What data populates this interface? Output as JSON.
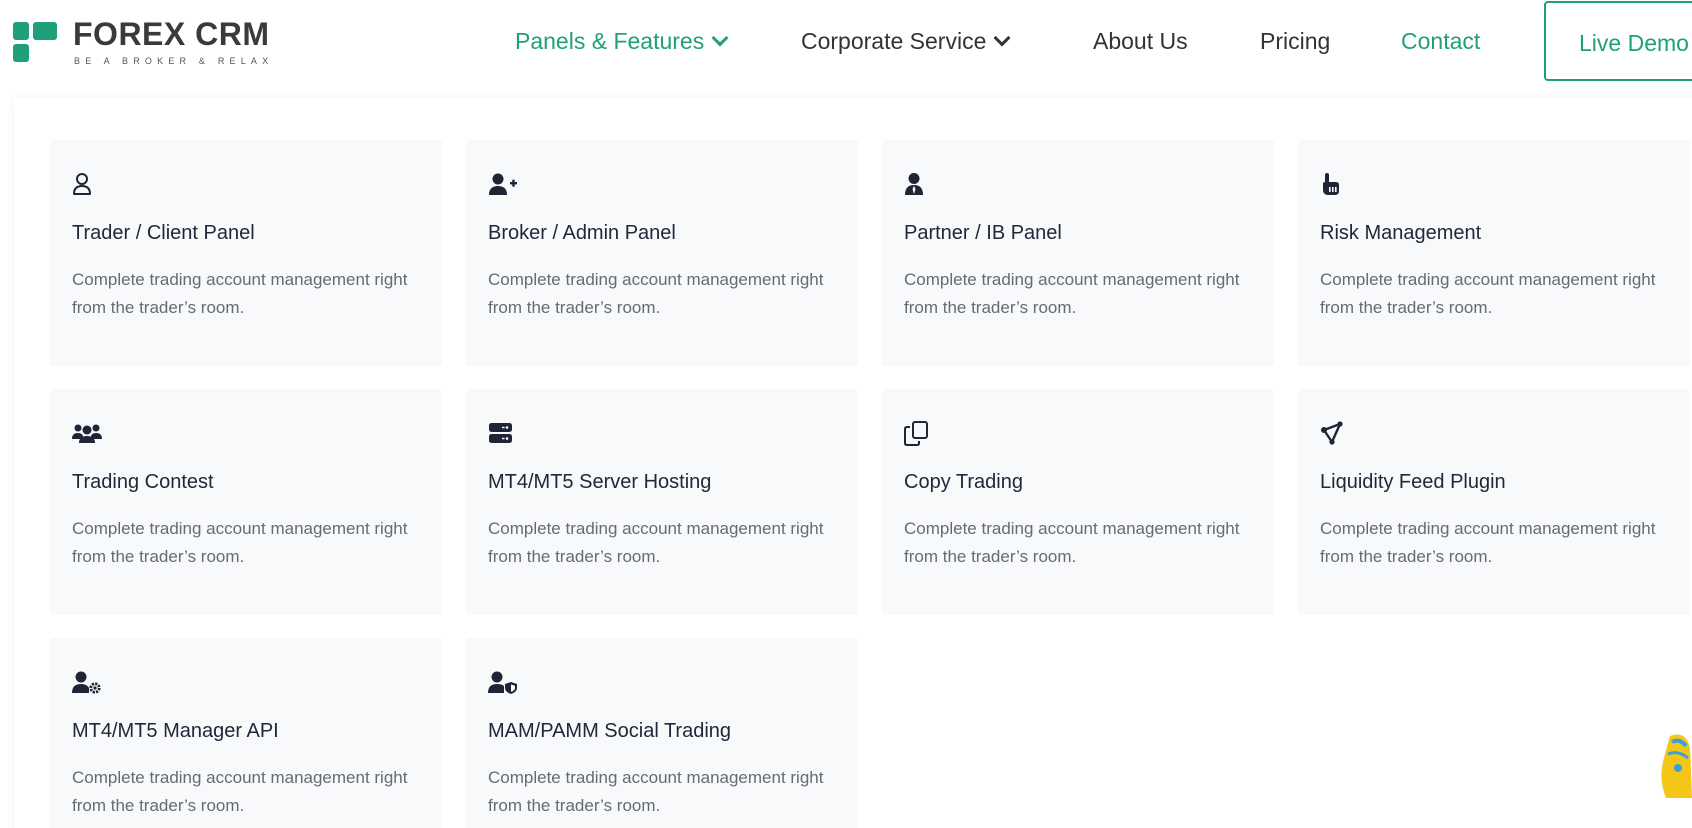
{
  "brand": {
    "name": "FOREX CRM",
    "tagline": "BE A BROKER & RELAX",
    "accent_color": "#1fa07a"
  },
  "nav": {
    "items": [
      {
        "label": "Panels & Features",
        "has_dropdown": true,
        "active": true
      },
      {
        "label": "Corporate Service",
        "has_dropdown": true,
        "active": false
      },
      {
        "label": "About Us",
        "has_dropdown": false,
        "active": false
      },
      {
        "label": "Pricing",
        "has_dropdown": false,
        "active": false
      },
      {
        "label": "Contact",
        "has_dropdown": false,
        "active": false
      }
    ],
    "cta_label": "Live Demo"
  },
  "features": [
    {
      "icon": "user-outline-icon",
      "title": "Trader / Client Panel",
      "desc": "Complete trading account management right from the trader’s room."
    },
    {
      "icon": "user-plus-icon",
      "title": "Broker / Admin Panel",
      "desc": "Complete trading account management right from the trader’s room."
    },
    {
      "icon": "user-tie-icon",
      "title": "Partner / IB Panel",
      "desc": "Complete trading account management right from the trader’s room."
    },
    {
      "icon": "hand-pointer-icon",
      "title": "Risk Management",
      "desc": "Complete trading account management right from the trader’s room."
    },
    {
      "icon": "users-group-icon",
      "title": "Trading Contest",
      "desc": "Complete trading account management right from the trader’s room."
    },
    {
      "icon": "server-icon",
      "title": "MT4/MT5 Server Hosting",
      "desc": "Complete trading account management right from the trader’s room."
    },
    {
      "icon": "copy-icon",
      "title": "Copy Trading",
      "desc": "Complete trading account management right from the trader’s room."
    },
    {
      "icon": "share-nodes-icon",
      "title": "Liquidity Feed Plugin",
      "desc": "Complete trading account management right from the trader’s room."
    },
    {
      "icon": "user-gear-icon",
      "title": "MT4/MT5 Manager API",
      "desc": "Complete trading account management right from the trader’s room."
    },
    {
      "icon": "user-shield-icon",
      "title": "MAM/PAMM Social Trading",
      "desc": "Complete trading account management right from the trader’s room."
    }
  ]
}
